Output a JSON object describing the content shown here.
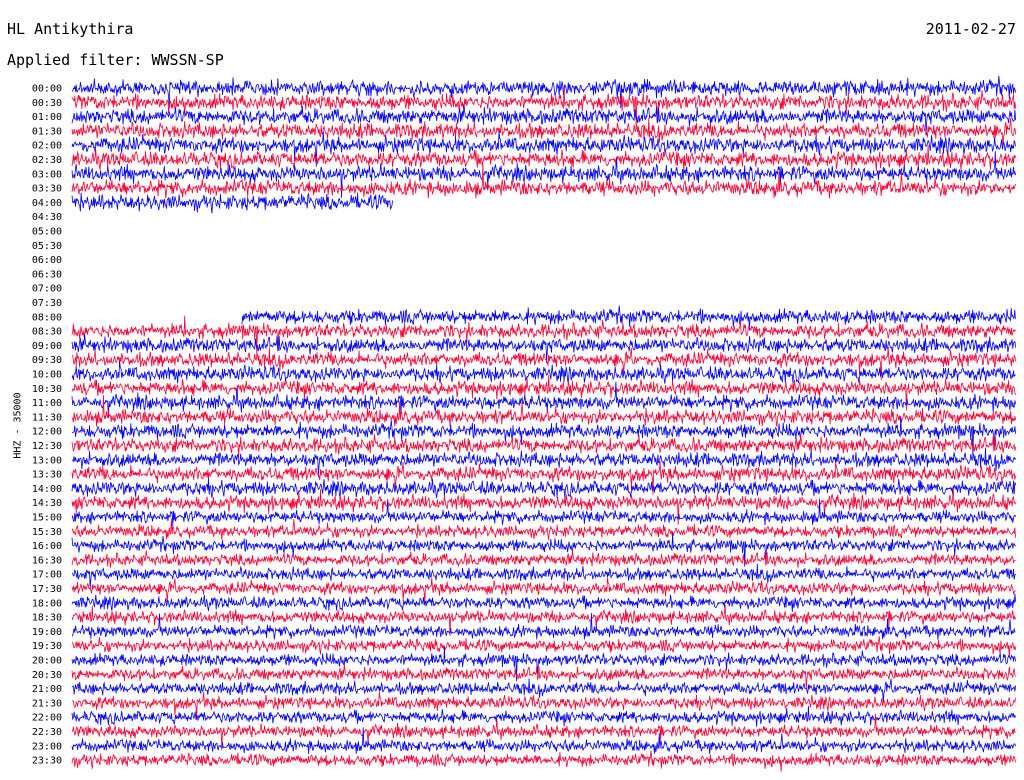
{
  "header": {
    "station": "HL Antikythira",
    "date": "2011-02-27",
    "filter": "Applied filter: WWSSN-SP"
  },
  "axis": {
    "ylabel": "HHZ - 35000"
  },
  "colors": {
    "trace_a": "#0000ff",
    "trace_b": "#ff0033",
    "background": "#ffffff"
  },
  "chart_data": {
    "type": "line",
    "title": "HL Antikythira",
    "subtitle": "Applied filter: WWSSN-SP",
    "ylabel": "HHZ - 35000",
    "xlabel": "",
    "row_labels": [
      "00:00",
      "00:30",
      "01:00",
      "01:30",
      "02:00",
      "02:30",
      "03:00",
      "03:30",
      "04:00",
      "04:30",
      "05:00",
      "05:30",
      "06:00",
      "06:30",
      "07:00",
      "07:30",
      "08:00",
      "08:30",
      "09:00",
      "09:30",
      "10:00",
      "10:30",
      "11:00",
      "11:30",
      "12:00",
      "12:30",
      "13:00",
      "13:30",
      "14:00",
      "14:30",
      "15:00",
      "15:30",
      "16:00",
      "16:30",
      "17:00",
      "17:30",
      "18:00",
      "18:30",
      "19:00",
      "19:30",
      "20:00",
      "20:30",
      "21:00",
      "21:30",
      "22:00",
      "22:30",
      "23:00",
      "23:30"
    ],
    "row_start": [
      "00:00",
      "00:30",
      "01:00",
      "01:30",
      "02:00",
      "02:30",
      "03:00",
      "03:30",
      "04:00",
      null,
      null,
      null,
      null,
      null,
      null,
      null,
      "08:00",
      "08:30",
      "09:00",
      "09:30",
      "10:00",
      "10:30",
      "11:00",
      "11:30",
      "12:00",
      "12:30",
      "13:00",
      "13:30",
      "14:00",
      "14:30",
      "15:00",
      "15:30",
      "16:00",
      "16:30",
      "17:00",
      "17:30",
      "18:00",
      "18:30",
      "19:00",
      "19:30",
      "20:00",
      "20:30",
      "21:00",
      "21:30",
      "22:00",
      "22:30",
      "23:00",
      "23:30"
    ],
    "row_coverage": [
      1,
      1,
      1,
      1,
      1,
      1,
      1,
      1,
      0.34,
      0,
      0,
      0,
      0,
      0,
      0,
      0,
      0.82,
      1,
      1,
      1,
      1,
      1,
      1,
      1,
      1,
      1,
      1,
      1,
      1,
      1,
      1,
      1,
      1,
      1,
      1,
      1,
      1,
      1,
      1,
      1,
      1,
      1,
      1,
      1,
      1,
      1,
      1,
      1
    ],
    "row_offset_start": [
      0,
      0,
      0,
      0,
      0,
      0,
      0,
      0,
      0,
      0,
      0,
      0,
      0,
      0,
      0,
      0,
      0.18,
      0,
      0,
      0,
      0,
      0,
      0,
      0,
      0,
      0,
      0,
      0,
      0,
      0,
      0,
      0,
      0,
      0,
      0,
      0,
      0,
      0,
      0,
      0,
      0,
      0,
      0,
      0,
      0,
      0,
      0,
      0
    ],
    "grid": false,
    "legend": "none"
  }
}
